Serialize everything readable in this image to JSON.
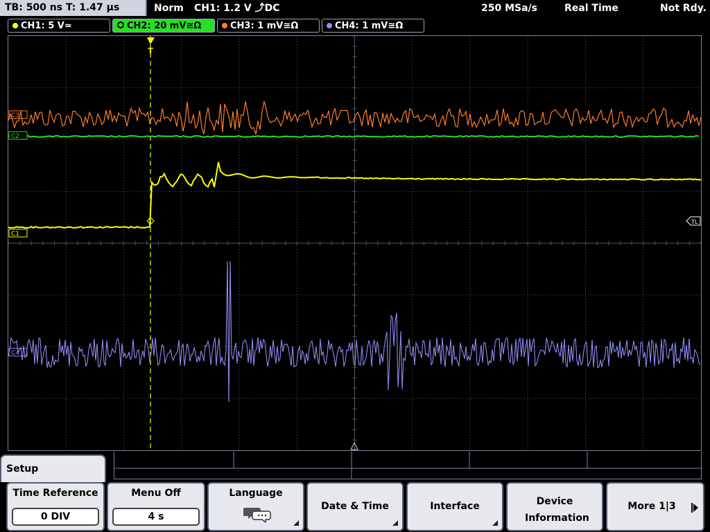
{
  "status": {
    "timebase": "TB: 500 ns   T: 1.47 µs",
    "trigger_mode": "Norm",
    "trigger_source": "CH1: 1.2 V ⤴DC",
    "sample_rate": "250 MSa/s",
    "acquisition": "Real Time",
    "state": "Not Rdy."
  },
  "channels": [
    {
      "label": "CH1: 5 V≃",
      "color": "#ffff00",
      "active": false
    },
    {
      "label": "CH2: 20 mV≅Ω",
      "color": "#25e025",
      "active": true
    },
    {
      "label": "CH3: 1 mV≅Ω",
      "color": "#ff7f2a",
      "active": false
    },
    {
      "label": "CH4: 1 mV≅Ω",
      "color": "#8e8cf0",
      "active": false
    }
  ],
  "markers": {
    "trigger": "T",
    "ch1": "C1",
    "ch2": "C2",
    "ch3": "C3",
    "ch4": "C4",
    "trigger_level": "TL"
  },
  "menu": {
    "title": "Setup",
    "softkeys": [
      {
        "label": "Time Reference",
        "value": "0 DIV"
      },
      {
        "label": "Menu Off",
        "value": "4 s"
      },
      {
        "label": "Language",
        "icon": "speech-bubble-icon"
      },
      {
        "label": "Date & Time"
      },
      {
        "label": "Interface"
      },
      {
        "label": "Device Information"
      },
      {
        "label": "More 1|3"
      }
    ]
  },
  "colors": {
    "ch1": "#ffff00",
    "ch2": "#25e025",
    "ch3": "#ff7f2a",
    "ch4": "#8e8cf0",
    "grid": "#505662",
    "softkey_bg": "#e6e8ee"
  }
}
